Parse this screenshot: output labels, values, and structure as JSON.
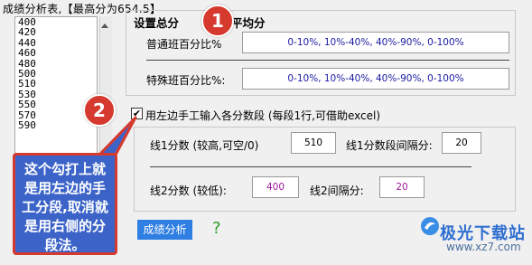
{
  "header": {
    "title": "成绩分析表,【最高分为654.5】"
  },
  "score_list": {
    "items": [
      "400",
      "420",
      "440",
      "460",
      "480",
      "500",
      "510",
      "530",
      "550",
      "570",
      "590"
    ]
  },
  "settings": {
    "title": "设置总分",
    "title_tail": "平均分",
    "normal_ratio_label": "普通班百分比%",
    "normal_ratio_value": "0-10%, 10%-40%, 40%-90%, 0-100%",
    "special_ratio_label": "特殊班百分比%:",
    "special_ratio_value": "0-10%, 10%-40%, 40%-90%, 0-100%"
  },
  "manual": {
    "checked": true,
    "check_mark": "✔",
    "label": "用左边手工输入各分数段 (每段1行,可借助excel)"
  },
  "lines": {
    "line1_label": "线1分数 (较高,可空/0)",
    "line1_score": "510",
    "interval1_label": "线1分数段间隔分:",
    "interval1_value": "20",
    "line2_label": "线2分数 (较低):",
    "line2_score": "400",
    "interval2_label": "线2间隔分:",
    "interval2_value": "20"
  },
  "actions": {
    "analyze_label": "成绩分析",
    "help_label": "?"
  },
  "annotations": {
    "marker1": "1",
    "marker2": "2",
    "callout_text": "这个勾打上就是用左边的手工分段,取消就是用右侧的分段法。"
  },
  "watermark": {
    "brand": "极光下载站",
    "url": "www.xz7.com"
  },
  "colors": {
    "accent": "#2f7ee2",
    "marker": "#d63a2f",
    "callout_bg": "#3c64c8",
    "help": "#2e9b2e"
  }
}
